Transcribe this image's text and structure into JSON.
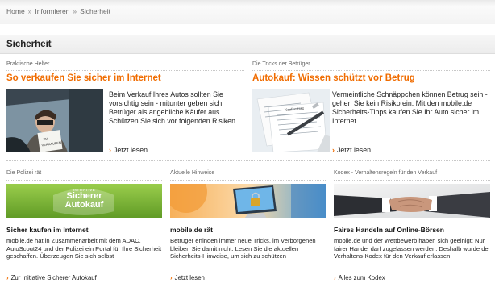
{
  "breadcrumb": {
    "items": [
      "Home",
      "Informieren",
      "Sicherheit"
    ],
    "separator": "»"
  },
  "page_title": "Sicherheit",
  "colors": {
    "accent": "#f06c00",
    "text": "#222222"
  },
  "features": [
    {
      "label": "Praktische Helfer",
      "headline": "So verkaufen Sie sicher im Internet",
      "text": "Beim Verkauf Ihres Autos sollten Sie vorsichtig sein - mitunter geben sich Betrüger als angebliche Käufer aus. Schützen Sie sich vor folgenden Risiken",
      "link": "Jetzt lesen",
      "image": "man-in-car-with-sign"
    },
    {
      "label": "Die Tricks der Betrüger",
      "headline": "Autokauf: Wissen schützt vor Betrug",
      "text": "Vermeintliche Schnäppchen können Betrug sein - gehen Sie kein Risiko ein. Mit den mobile.de Sicherheits-Tipps kaufen Sie Ihr Auto sicher im Internet",
      "link": "Jetzt lesen",
      "image": "contract-papers-with-pen"
    }
  ],
  "cards": [
    {
      "label": "Die Polizei rät",
      "title": "Sicher kaufen im Internet",
      "text": "mobile.de hat in Zusammenarbeit mit dem ADAC, AutoScout24 und der Polizei ein Portal für Ihre Sicherheit geschaffen. Überzeugen Sie sich selbst",
      "link": "Zur Initiative Sicherer Autokauf",
      "logo_small": "INITIATIVE",
      "logo_line1": "Sicherer",
      "logo_line2": "Autokauf"
    },
    {
      "label": "Aktuelle Hinweise",
      "title": "mobile.de rät",
      "text": "Betrüger erfinden immer neue Tricks, im Verborgenen bleiben Sie damit nicht. Lesen Sie die aktuellen Sicherheits-Hinweise, um sich zu schützen",
      "link": "Jetzt lesen",
      "image": "padlock-on-monitor"
    },
    {
      "label": "Kodex - Verhaltensregeln für den Verkauf",
      "title": "Faires Handeln auf Online-Börsen",
      "text": "mobile.de und der Wettbewerb haben sich geeinigt: Nur fairer Handel darf zugelassen werden. Deshalb wurde der Verhaltens-Kodex für den Verkauf erlassen",
      "link": "Alles zum Kodex",
      "image": "handshake"
    }
  ]
}
